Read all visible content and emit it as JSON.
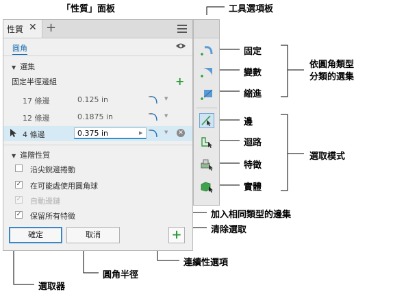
{
  "callouts": {
    "properties_panel": "「性質」面板",
    "toolbar": "工具選項板",
    "constant": "固定",
    "variable": "變數",
    "setback": "縮進",
    "select_sets_by_type": [
      "依圓角類型",
      "分類的選集"
    ],
    "edge": "邊",
    "loop": "迴路",
    "feature": "特徵",
    "solid": "實體",
    "selection_mode": "選取模式",
    "add_same_type_set": "加入相同類型的邊集",
    "clear_selection": "清除選取",
    "continuity_option": "連續性選項",
    "fillet_radius": "圓角半徑",
    "selector": "選取器"
  },
  "panel": {
    "tab_label": "性質",
    "close_glyph": "✕",
    "add_tab_glyph": "+",
    "fillet_type": "圓角",
    "selection_section": "選集",
    "edge_group_label": "固定半徑邊組",
    "rows": [
      {
        "count": "17 條邊",
        "radius": "0.125 in"
      },
      {
        "count": "12 條邊",
        "radius": "0.1875 in"
      },
      {
        "count": "4 條邊",
        "radius": "0.375 in"
      }
    ],
    "advanced_section": "進階性質",
    "options": [
      {
        "label": "沿尖銳邊捲動",
        "checked": false,
        "disabled": false
      },
      {
        "label": "在可能處使用圓角球",
        "checked": true,
        "disabled": false
      },
      {
        "label": "自動邊鏈",
        "checked": true,
        "disabled": true
      },
      {
        "label": "保留所有特徵",
        "checked": true,
        "disabled": false
      }
    ],
    "ok_label": "確定",
    "cancel_label": "取消",
    "add_glyph": "+"
  },
  "colors": {
    "accent_blue": "#1f6fb2",
    "add_green": "#2e9b3a",
    "active_row": "#d6eaf6"
  }
}
